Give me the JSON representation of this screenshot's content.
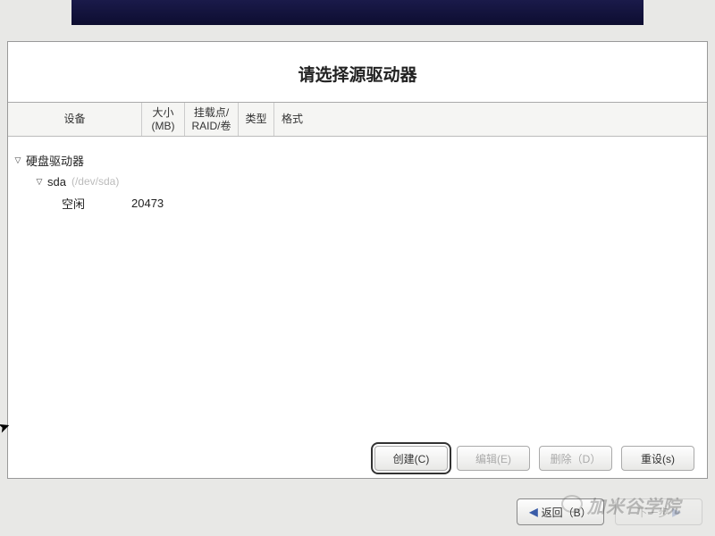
{
  "title": "请选择源驱动器",
  "headers": {
    "device": "设备",
    "size_line1": "大小",
    "size_line2": "(MB)",
    "mount_line1": "挂载点/",
    "mount_line2": "RAID/卷",
    "type": "类型",
    "format": "格式"
  },
  "tree": {
    "root_label": "硬盘驱动器",
    "disk_label": "sda",
    "disk_path": "(/dev/sda)",
    "free_label": "空闲",
    "free_size": "20473"
  },
  "buttons": {
    "create": "创建(C)",
    "edit": "编辑(E)",
    "delete": "删除（D）",
    "reset": "重设(s)",
    "back": "返回（B）",
    "next": "下一步"
  },
  "watermark": "加米谷学院"
}
